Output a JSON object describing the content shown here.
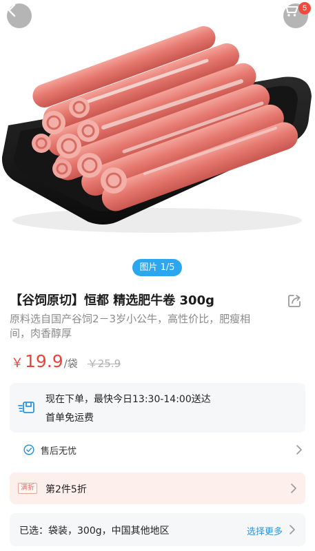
{
  "header": {
    "cart_badge_count": "5",
    "back_icon": "chevron-left-icon",
    "cart_icon": "shopping-cart-icon"
  },
  "gallery": {
    "pager_label": "图片 1/5"
  },
  "product": {
    "title": "【谷饲原切】恒都 精选肥牛卷 300g",
    "subtitle": "原料选自国产谷饲2－3岁小公牛，高性价比，肥瘦相间，肉香醇厚",
    "price_symbol": "￥",
    "price": "19.9",
    "unit": "/袋",
    "original_price": "￥25.9"
  },
  "delivery": {
    "line1": "现在下单，最快今日13:30-14:00送达",
    "line2": "首单免运费"
  },
  "service": {
    "label": "售后无忧"
  },
  "promo": {
    "tag": "满折",
    "text": "第2件5折"
  },
  "selection": {
    "text": "已选：袋装，300g，中国其他地区",
    "more_label": "选择更多"
  },
  "colors": {
    "accent_blue": "#2aa7ef",
    "price_red": "#f0413a",
    "badge_red": "#f04a3f",
    "link_blue": "#2a94e3"
  }
}
